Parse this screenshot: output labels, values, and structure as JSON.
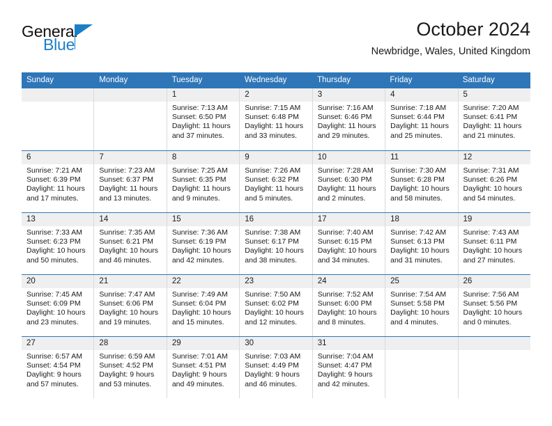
{
  "brand": {
    "name_top": "General",
    "name_bottom": "Blue",
    "accent_color": "#1b7ec7"
  },
  "header": {
    "title": "October 2024",
    "subtitle": "Newbridge, Wales, United Kingdom"
  },
  "theme": {
    "header_blue": "#2e76b8",
    "day_band_gray": "#efefef",
    "cell_divider": "#d9d9d9"
  },
  "calendar": {
    "weekday_headers": [
      "Sunday",
      "Monday",
      "Tuesday",
      "Wednesday",
      "Thursday",
      "Friday",
      "Saturday"
    ],
    "weeks": [
      [
        {
          "day": "",
          "sunrise": "",
          "sunset": "",
          "daylight": ""
        },
        {
          "day": "",
          "sunrise": "",
          "sunset": "",
          "daylight": ""
        },
        {
          "day": "1",
          "sunrise": "Sunrise: 7:13 AM",
          "sunset": "Sunset: 6:50 PM",
          "daylight": "Daylight: 11 hours and 37 minutes."
        },
        {
          "day": "2",
          "sunrise": "Sunrise: 7:15 AM",
          "sunset": "Sunset: 6:48 PM",
          "daylight": "Daylight: 11 hours and 33 minutes."
        },
        {
          "day": "3",
          "sunrise": "Sunrise: 7:16 AM",
          "sunset": "Sunset: 6:46 PM",
          "daylight": "Daylight: 11 hours and 29 minutes."
        },
        {
          "day": "4",
          "sunrise": "Sunrise: 7:18 AM",
          "sunset": "Sunset: 6:44 PM",
          "daylight": "Daylight: 11 hours and 25 minutes."
        },
        {
          "day": "5",
          "sunrise": "Sunrise: 7:20 AM",
          "sunset": "Sunset: 6:41 PM",
          "daylight": "Daylight: 11 hours and 21 minutes."
        }
      ],
      [
        {
          "day": "6",
          "sunrise": "Sunrise: 7:21 AM",
          "sunset": "Sunset: 6:39 PM",
          "daylight": "Daylight: 11 hours and 17 minutes."
        },
        {
          "day": "7",
          "sunrise": "Sunrise: 7:23 AM",
          "sunset": "Sunset: 6:37 PM",
          "daylight": "Daylight: 11 hours and 13 minutes."
        },
        {
          "day": "8",
          "sunrise": "Sunrise: 7:25 AM",
          "sunset": "Sunset: 6:35 PM",
          "daylight": "Daylight: 11 hours and 9 minutes."
        },
        {
          "day": "9",
          "sunrise": "Sunrise: 7:26 AM",
          "sunset": "Sunset: 6:32 PM",
          "daylight": "Daylight: 11 hours and 5 minutes."
        },
        {
          "day": "10",
          "sunrise": "Sunrise: 7:28 AM",
          "sunset": "Sunset: 6:30 PM",
          "daylight": "Daylight: 11 hours and 2 minutes."
        },
        {
          "day": "11",
          "sunrise": "Sunrise: 7:30 AM",
          "sunset": "Sunset: 6:28 PM",
          "daylight": "Daylight: 10 hours and 58 minutes."
        },
        {
          "day": "12",
          "sunrise": "Sunrise: 7:31 AM",
          "sunset": "Sunset: 6:26 PM",
          "daylight": "Daylight: 10 hours and 54 minutes."
        }
      ],
      [
        {
          "day": "13",
          "sunrise": "Sunrise: 7:33 AM",
          "sunset": "Sunset: 6:23 PM",
          "daylight": "Daylight: 10 hours and 50 minutes."
        },
        {
          "day": "14",
          "sunrise": "Sunrise: 7:35 AM",
          "sunset": "Sunset: 6:21 PM",
          "daylight": "Daylight: 10 hours and 46 minutes."
        },
        {
          "day": "15",
          "sunrise": "Sunrise: 7:36 AM",
          "sunset": "Sunset: 6:19 PM",
          "daylight": "Daylight: 10 hours and 42 minutes."
        },
        {
          "day": "16",
          "sunrise": "Sunrise: 7:38 AM",
          "sunset": "Sunset: 6:17 PM",
          "daylight": "Daylight: 10 hours and 38 minutes."
        },
        {
          "day": "17",
          "sunrise": "Sunrise: 7:40 AM",
          "sunset": "Sunset: 6:15 PM",
          "daylight": "Daylight: 10 hours and 34 minutes."
        },
        {
          "day": "18",
          "sunrise": "Sunrise: 7:42 AM",
          "sunset": "Sunset: 6:13 PM",
          "daylight": "Daylight: 10 hours and 31 minutes."
        },
        {
          "day": "19",
          "sunrise": "Sunrise: 7:43 AM",
          "sunset": "Sunset: 6:11 PM",
          "daylight": "Daylight: 10 hours and 27 minutes."
        }
      ],
      [
        {
          "day": "20",
          "sunrise": "Sunrise: 7:45 AM",
          "sunset": "Sunset: 6:09 PM",
          "daylight": "Daylight: 10 hours and 23 minutes."
        },
        {
          "day": "21",
          "sunrise": "Sunrise: 7:47 AM",
          "sunset": "Sunset: 6:06 PM",
          "daylight": "Daylight: 10 hours and 19 minutes."
        },
        {
          "day": "22",
          "sunrise": "Sunrise: 7:49 AM",
          "sunset": "Sunset: 6:04 PM",
          "daylight": "Daylight: 10 hours and 15 minutes."
        },
        {
          "day": "23",
          "sunrise": "Sunrise: 7:50 AM",
          "sunset": "Sunset: 6:02 PM",
          "daylight": "Daylight: 10 hours and 12 minutes."
        },
        {
          "day": "24",
          "sunrise": "Sunrise: 7:52 AM",
          "sunset": "Sunset: 6:00 PM",
          "daylight": "Daylight: 10 hours and 8 minutes."
        },
        {
          "day": "25",
          "sunrise": "Sunrise: 7:54 AM",
          "sunset": "Sunset: 5:58 PM",
          "daylight": "Daylight: 10 hours and 4 minutes."
        },
        {
          "day": "26",
          "sunrise": "Sunrise: 7:56 AM",
          "sunset": "Sunset: 5:56 PM",
          "daylight": "Daylight: 10 hours and 0 minutes."
        }
      ],
      [
        {
          "day": "27",
          "sunrise": "Sunrise: 6:57 AM",
          "sunset": "Sunset: 4:54 PM",
          "daylight": "Daylight: 9 hours and 57 minutes."
        },
        {
          "day": "28",
          "sunrise": "Sunrise: 6:59 AM",
          "sunset": "Sunset: 4:52 PM",
          "daylight": "Daylight: 9 hours and 53 minutes."
        },
        {
          "day": "29",
          "sunrise": "Sunrise: 7:01 AM",
          "sunset": "Sunset: 4:51 PM",
          "daylight": "Daylight: 9 hours and 49 minutes."
        },
        {
          "day": "30",
          "sunrise": "Sunrise: 7:03 AM",
          "sunset": "Sunset: 4:49 PM",
          "daylight": "Daylight: 9 hours and 46 minutes."
        },
        {
          "day": "31",
          "sunrise": "Sunrise: 7:04 AM",
          "sunset": "Sunset: 4:47 PM",
          "daylight": "Daylight: 9 hours and 42 minutes."
        },
        {
          "day": "",
          "sunrise": "",
          "sunset": "",
          "daylight": ""
        },
        {
          "day": "",
          "sunrise": "",
          "sunset": "",
          "daylight": ""
        }
      ]
    ]
  }
}
